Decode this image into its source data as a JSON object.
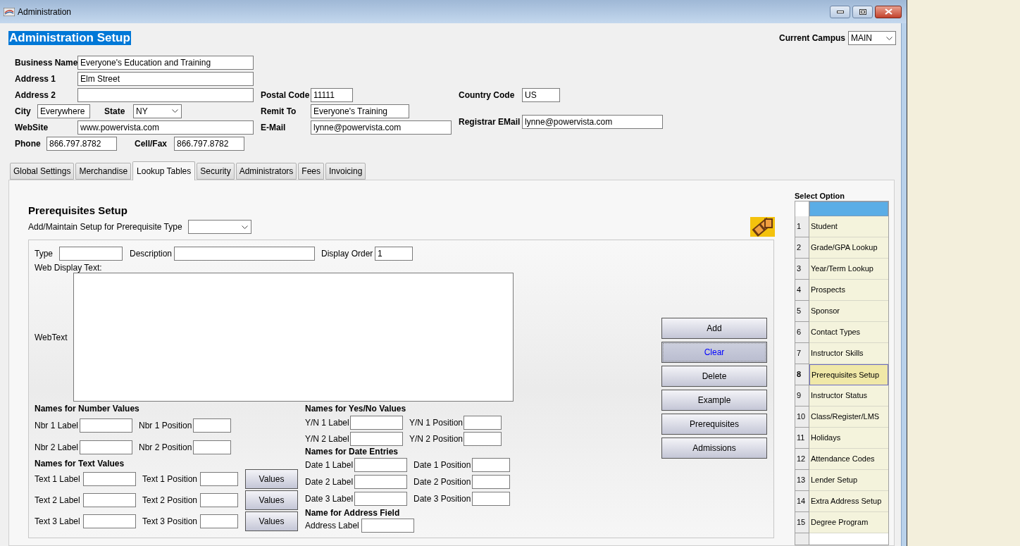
{
  "window": {
    "title": "Administration"
  },
  "heading": "Administration Setup",
  "campus": {
    "label": "Current Campus",
    "value": "MAIN"
  },
  "business_fields": {
    "left": [
      [
        {
          "label": "Business Name",
          "value": "Everyone's Education and Training",
          "kind": "text"
        }
      ],
      [
        {
          "label": "Address 1",
          "value": "Elm Street",
          "kind": "text"
        }
      ],
      [
        {
          "label": "Address 2",
          "kind": "text"
        }
      ],
      [
        {
          "label": "City",
          "value": "Everywhere",
          "kind": "text"
        },
        {
          "label": "State",
          "value": "NY",
          "kind": "select"
        }
      ],
      [
        {
          "label": "WebSite",
          "value": "www.powervista.com",
          "kind": "text"
        }
      ],
      [
        {
          "label": "Phone",
          "value": "866.797.8782",
          "kind": "text"
        },
        {
          "label": "Cell/Fax",
          "value": "866.797.8782",
          "kind": "text"
        }
      ]
    ],
    "middle": [
      [
        {
          "label": "Postal Code",
          "value": "11111",
          "kind": "text"
        }
      ],
      [
        {
          "label": "Remit To",
          "value": "Everyone's Training",
          "kind": "text"
        }
      ],
      [
        {
          "label": "E-Mail",
          "value": "lynne@powervista.com",
          "kind": "text"
        }
      ]
    ],
    "right": [
      [
        {
          "label": "Country Code",
          "value": "US",
          "kind": "text"
        }
      ],
      [
        {
          "label": "Registrar EMail",
          "value": "lynne@powervista.com",
          "kind": "text"
        }
      ]
    ]
  },
  "tabs": [
    {
      "label": "Global Settings",
      "selected": false
    },
    {
      "label": "Merchandise",
      "selected": false
    },
    {
      "label": "Lookup Tables",
      "selected": true
    },
    {
      "label": "Security",
      "selected": false
    },
    {
      "label": "Administrators",
      "selected": false
    },
    {
      "label": "Fees",
      "selected": false
    },
    {
      "label": "Invoicing",
      "selected": false
    }
  ],
  "setup": {
    "title": "Prerequisites Setup",
    "type_label": "Add/Maintain Setup for Prerequisite Type",
    "fields": [
      {
        "label": "Type"
      },
      {
        "label": "Description"
      },
      {
        "label": "Display Order",
        "value": "1"
      }
    ],
    "web_display_label": "Web Display Text:",
    "webtext_label": "WebText",
    "groups_left": [
      {
        "title": "Names for Number Values",
        "rows": [
          {
            "fields": [
              "Nbr 1 Label",
              "Nbr 1 Position"
            ]
          },
          {
            "fields": [
              "Nbr 2 Label",
              "Nbr 2 Position"
            ]
          }
        ]
      },
      {
        "title": "Names for Text Values",
        "rows": [
          {
            "fields": [
              "Text 1 Label",
              "Text 1 Position"
            ],
            "button": "Values"
          },
          {
            "fields": [
              "Text 2 Label",
              "Text 2 Position"
            ],
            "button": "Values"
          },
          {
            "fields": [
              "Text 3 Label",
              "Text 3 Position"
            ],
            "button": "Values"
          }
        ]
      }
    ],
    "groups_right": [
      {
        "title": "Names for Yes/No Values",
        "rows": [
          {
            "fields": [
              "Y/N 1 Label",
              "Y/N 1 Position"
            ]
          },
          {
            "fields": [
              "Y/N 2 Label",
              "Y/N 2 Position"
            ]
          }
        ]
      },
      {
        "title": "Names for Date Entries",
        "rows": [
          {
            "fields": [
              "Date 1 Label",
              "Date 1 Position"
            ]
          },
          {
            "fields": [
              "Date 2 Label",
              "Date 2 Position"
            ]
          },
          {
            "fields": [
              "Date 3 Label",
              "Date 3 Position"
            ]
          }
        ]
      },
      {
        "title": "Name for Address Field",
        "rows": [
          {
            "fields": [
              "Address Label"
            ]
          }
        ]
      }
    ],
    "buttons": [
      {
        "label": "Add",
        "focused": false
      },
      {
        "label": "Clear",
        "focused": true
      },
      {
        "label": "Delete",
        "focused": false
      },
      {
        "label": "Example",
        "focused": false
      },
      {
        "label": "Prerequisites",
        "focused": false
      },
      {
        "label": "Admissions",
        "focused": false
      }
    ]
  },
  "select_option": {
    "title": "Select Option",
    "items": [
      {
        "number": "1",
        "label": "Student",
        "selected": false
      },
      {
        "number": "2",
        "label": "Grade/GPA Lookup",
        "selected": false
      },
      {
        "number": "3",
        "label": "Year/Term Lookup",
        "selected": false
      },
      {
        "number": "4",
        "label": "Prospects",
        "selected": false
      },
      {
        "number": "5",
        "label": "Sponsor",
        "selected": false
      },
      {
        "number": "6",
        "label": "Contact Types",
        "selected": false
      },
      {
        "number": "7",
        "label": "Instructor Skills",
        "selected": false
      },
      {
        "number": "8",
        "label": "Prerequisites Setup",
        "selected": true
      },
      {
        "number": "9",
        "label": "Instructor Status",
        "selected": false
      },
      {
        "number": "10",
        "label": "Class/Register/LMS",
        "selected": false
      },
      {
        "number": "11",
        "label": "Holidays",
        "selected": false
      },
      {
        "number": "12",
        "label": "Attendance Codes",
        "selected": false
      },
      {
        "number": "13",
        "label": "Lender Setup",
        "selected": false
      },
      {
        "number": "14",
        "label": "Extra Address Setup",
        "selected": false
      },
      {
        "number": "15",
        "label": "Degree Program",
        "selected": false
      }
    ]
  }
}
